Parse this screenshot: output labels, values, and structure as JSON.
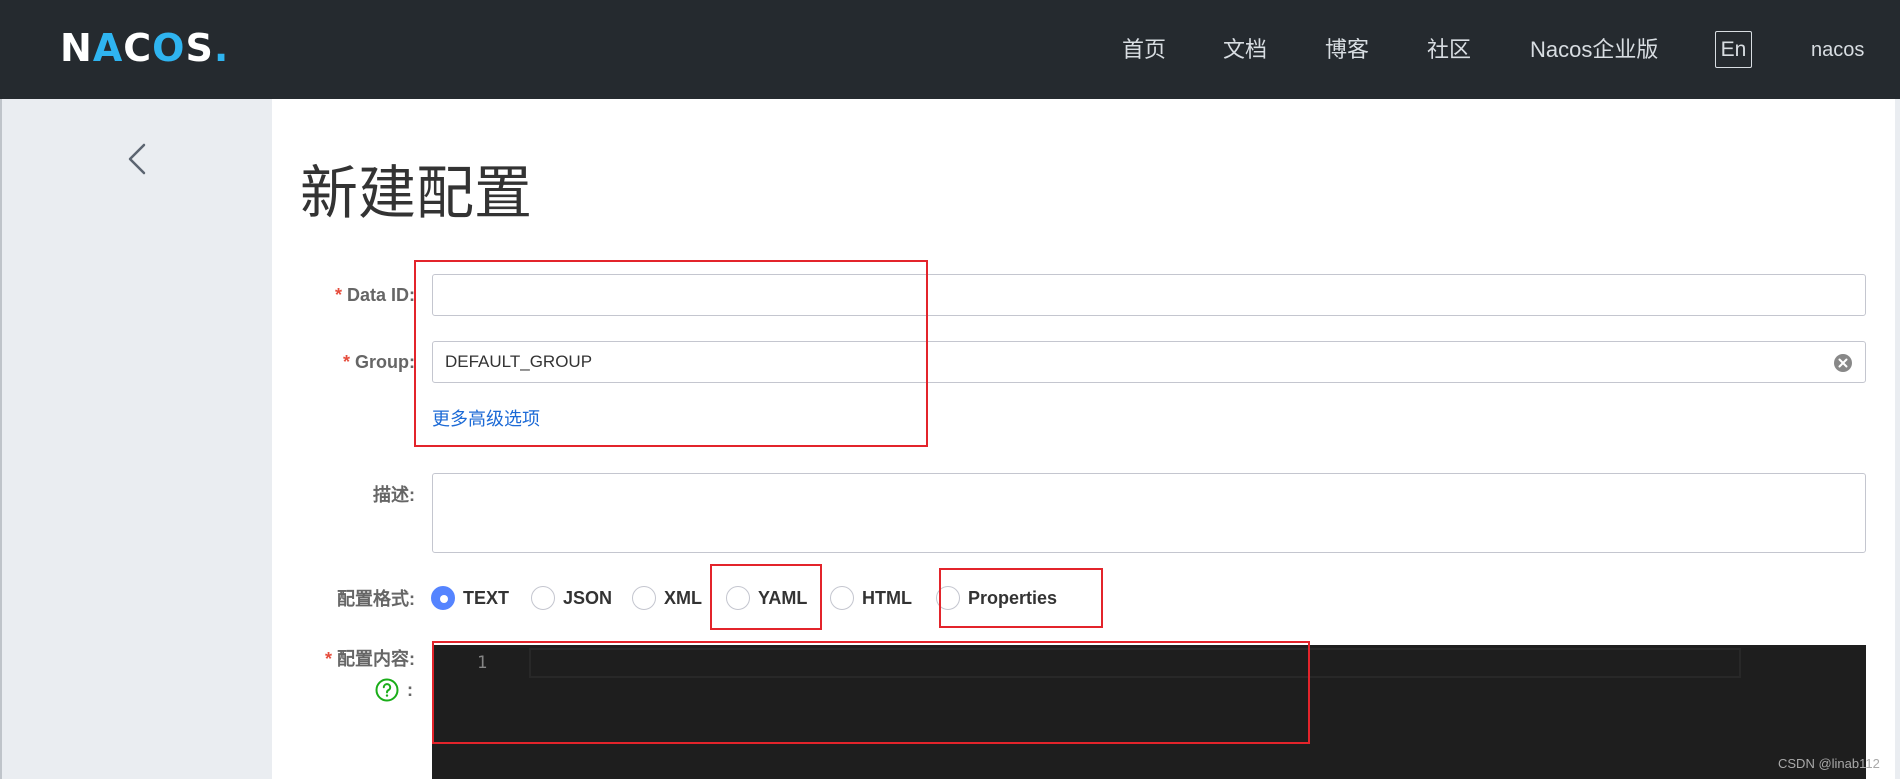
{
  "header": {
    "logo_text": "NACOS.",
    "nav": [
      {
        "label": "首页"
      },
      {
        "label": "文档"
      },
      {
        "label": "博客"
      },
      {
        "label": "社区"
      },
      {
        "label": "Nacos企业版"
      }
    ],
    "lang_button": "En",
    "user": "nacos"
  },
  "page": {
    "title": "新建配置"
  },
  "form": {
    "data_id": {
      "required_mark": "*",
      "label": "Data ID:",
      "value": ""
    },
    "group": {
      "required_mark": "*",
      "label": "Group:",
      "value": "DEFAULT_GROUP"
    },
    "advanced_link": "更多高级选项",
    "description": {
      "label": "描述:",
      "value": ""
    },
    "format": {
      "label": "配置格式:",
      "selected": "TEXT",
      "options": [
        "TEXT",
        "JSON",
        "XML",
        "YAML",
        "HTML",
        "Properties"
      ]
    },
    "content": {
      "required_mark": "*",
      "label": "配置内容:",
      "help_suffix": ":",
      "line_number": "1"
    }
  },
  "watermark": "CSDN @linab112",
  "colors": {
    "header_bg": "#252a2f",
    "sidebar_bg": "#eaedf1",
    "accent": "#5584ff",
    "link": "#1c6ad6",
    "required": "#e64d3d",
    "annotation": "#e3242b",
    "editor_bg": "#1e1e1e",
    "help_icon": "#1aad19"
  },
  "icons": {
    "back": "chevron-left-icon",
    "clear": "clear-circle-icon",
    "help": "question-circle-icon"
  }
}
